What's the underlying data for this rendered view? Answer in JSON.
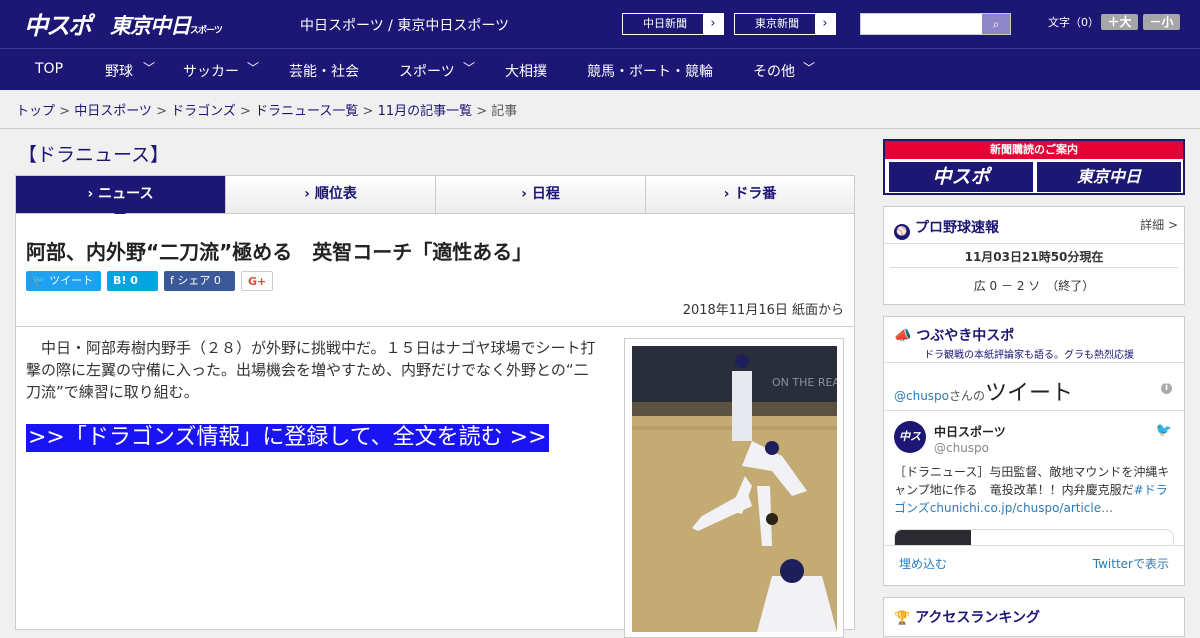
{
  "header": {
    "logo_chuspo": "中スポ",
    "logo_tokyo": "東京中日",
    "logo_sports": "スポーツ",
    "site": "中日スポーツ / 東京中日スポーツ",
    "btn_chunichi": "中日新聞",
    "btn_tokyo": "東京新聞",
    "font_size": "文字（0）",
    "font_up": "＋大",
    "font_down": "－小"
  },
  "nav": [
    "TOP",
    "野球",
    "サッカー",
    "芸能・社会",
    "スポーツ",
    "大相撲",
    "競馬・ボート・競輪",
    "その他"
  ],
  "breadcrumb": [
    "トップ",
    "中日スポーツ",
    "ドラゴンズ",
    "ドラニュース一覧",
    "11月の記事一覧",
    "記事"
  ],
  "section": "【ドラニュース】",
  "tabs": [
    "ニュース",
    "順位表",
    "日程",
    "ドラ番"
  ],
  "article": {
    "title": "阿部、内外野“二刀流”極める　英智コーチ「適性ある」",
    "tweet": "ツイート",
    "hatena": "B! 0",
    "share": "シェア 0",
    "gplus": "G+",
    "date": "2018年11月16日 紙面から",
    "body": "中日・阿部寿樹内野手（２８）が外野に挑戦中だ。１５日はナゴヤ球場でシート打撃の際に左翼の守備に入った。出場機会を増やすため、内野だけでなく外野との“二刀流”で練習に取り組む。",
    "register": ">>「ドラゴンズ情報」に登録して、全文を読む >>"
  },
  "sidebar": {
    "ad_title": "新聞購読のご案内",
    "ad_a": "中スポ",
    "ad_b": "東京中日",
    "baseball_title": "プロ野球速報",
    "baseball_detail": "詳細 >",
    "baseball_time": "11月03日21時50分現在",
    "baseball_score": "広 0 － 2 ソ　（終了）",
    "tw_title": "つぶやき中スポ",
    "tw_sub": "ドラ観戦の本紙評論家も語る。グラも熱烈応援",
    "tw_handle": "@chuspo",
    "tw_san": "さんの",
    "tw_tweet": "ツイート",
    "tw_name": "中日スポーツ",
    "tw_id": "@chuspo",
    "tw_text": "［ドラニュース］与田監督、敵地マウンドを沖縄キャンプ地に作る　竜投改革！！内弁慶克服だ",
    "tw_link": "#ドラゴンズchunichi.co.jp/chuspo/article…",
    "tw_embed": "埋め込む",
    "tw_view": "Twitterで表示",
    "ranking_title": "アクセスランキング"
  }
}
